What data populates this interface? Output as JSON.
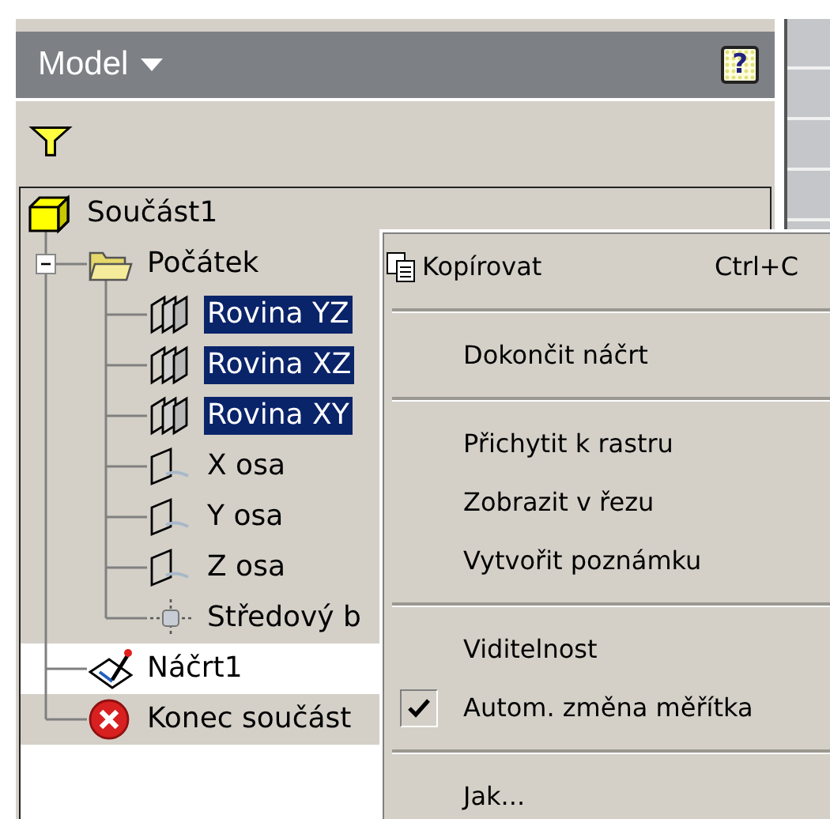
{
  "header": {
    "title": "Model",
    "help": "?"
  },
  "tree": [
    {
      "label": "Součást1",
      "kind": "part",
      "selected": false,
      "active": false,
      "children": [
        {
          "label": "Počátek",
          "kind": "folder",
          "selected": false,
          "active": false,
          "expanded": true,
          "children": [
            {
              "label": "Rovina YZ",
              "kind": "plane",
              "selected": true,
              "active": false
            },
            {
              "label": "Rovina XZ",
              "kind": "plane",
              "selected": true,
              "active": false
            },
            {
              "label": "Rovina XY",
              "kind": "plane",
              "selected": true,
              "active": false
            },
            {
              "label": "X osa",
              "kind": "axis",
              "selected": false,
              "active": false
            },
            {
              "label": "Y osa",
              "kind": "axis",
              "selected": false,
              "active": false
            },
            {
              "label": "Z osa",
              "kind": "axis",
              "selected": false,
              "active": false
            },
            {
              "label": "Středový b",
              "kind": "point",
              "selected": false,
              "active": false
            }
          ]
        },
        {
          "label": "Náčrt1",
          "kind": "sketch",
          "selected": false,
          "active": true
        },
        {
          "label": "Konec součást",
          "kind": "end",
          "selected": false,
          "active": false
        }
      ]
    }
  ],
  "context_menu": [
    {
      "kind": "icon-item",
      "label": "Kopírovat",
      "shortcut": "Ctrl+C",
      "checked": false
    },
    {
      "kind": "separator"
    },
    {
      "kind": "item",
      "label": "Dokončit náčrt",
      "checked": false
    },
    {
      "kind": "separator"
    },
    {
      "kind": "item",
      "label": "Přichytit k rastru",
      "checked": false
    },
    {
      "kind": "item",
      "label": "Zobrazit v řezu",
      "checked": false
    },
    {
      "kind": "item",
      "label": "Vytvořit poznámku",
      "checked": false
    },
    {
      "kind": "separator"
    },
    {
      "kind": "item",
      "label": "Viditelnost",
      "checked": false
    },
    {
      "kind": "item",
      "label": "Autom. změna měřítka",
      "checked": true
    },
    {
      "kind": "separator"
    },
    {
      "kind": "item",
      "label": "Jak...",
      "checked": false
    }
  ]
}
